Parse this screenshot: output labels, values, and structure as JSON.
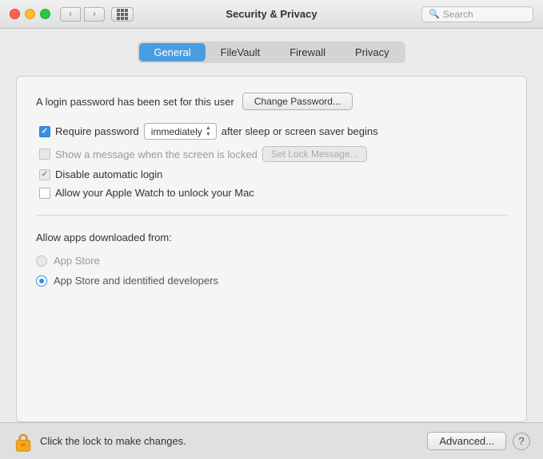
{
  "titlebar": {
    "title": "Security & Privacy",
    "search_placeholder": "Search"
  },
  "tabs": {
    "items": [
      "General",
      "FileVault",
      "Firewall",
      "Privacy"
    ],
    "active": "General"
  },
  "general": {
    "login_password_text": "A login password has been set for this user",
    "change_password_label": "Change Password...",
    "require_password_label": "Require password",
    "immediately_value": "immediately",
    "after_sleep_text": "after sleep or screen saver begins",
    "show_message_label": "Show a message when the screen is locked",
    "set_lock_message_label": "Set Lock Message...",
    "disable_auto_login_label": "Disable automatic login",
    "allow_watch_label": "Allow your Apple Watch to unlock your Mac"
  },
  "allow_apps": {
    "title": "Allow apps downloaded from:",
    "option1": "App Store",
    "option2": "App Store and identified developers"
  },
  "bottom": {
    "lock_text": "Click the lock to make changes.",
    "advanced_label": "Advanced...",
    "help_label": "?"
  }
}
